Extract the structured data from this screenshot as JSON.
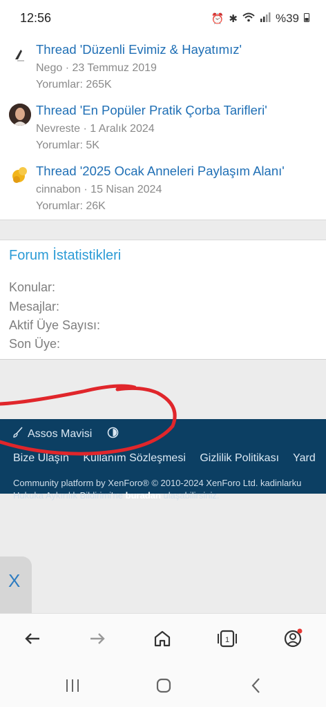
{
  "status_bar": {
    "time": "12:56",
    "battery": "%39"
  },
  "threads": [
    {
      "title": "Thread 'Düzenli Evimiz & Hayatımız'",
      "meta": "Nego · 23 Temmuz 2019",
      "replies": "Yorumlar: 265K"
    },
    {
      "title": "Thread 'En Popüler Pratik Çorba Tarifleri'",
      "meta": "Nevreste · 1 Aralık 2024",
      "replies": "Yorumlar: 5K"
    },
    {
      "title": "Thread '2025 Ocak Anneleri Paylaşım Alanı'",
      "meta": "cinnabon · 15 Nisan 2024",
      "replies": "Yorumlar: 26K"
    }
  ],
  "stats": {
    "title": "Forum İstatistikleri",
    "rows": [
      "Konular:",
      "Mesajlar:",
      "Aktif Üye Sayısı:",
      "Son Üye:"
    ]
  },
  "footer": {
    "style_name": "Assos Mavisi",
    "links": [
      "Bize Ulaşın",
      "Kullanım Sözleşmesi",
      "Gizlilik Politikası",
      "Yard"
    ],
    "copyright": "Community platform by XenForo® © 2010-2024 XenForo Ltd. kadinlarku",
    "notice_prefix": "Hukuka Aykırılık Bildirimi'ne ",
    "notice_link": "buradan",
    "notice_suffix": " ulaşabilirsiniz."
  },
  "side_tab": {
    "label": "X"
  },
  "colors": {
    "link": "#1f6fb5",
    "footer_bg": "#0c3f63",
    "accent": "#2b9bd6",
    "annotation": "#e0262b"
  }
}
